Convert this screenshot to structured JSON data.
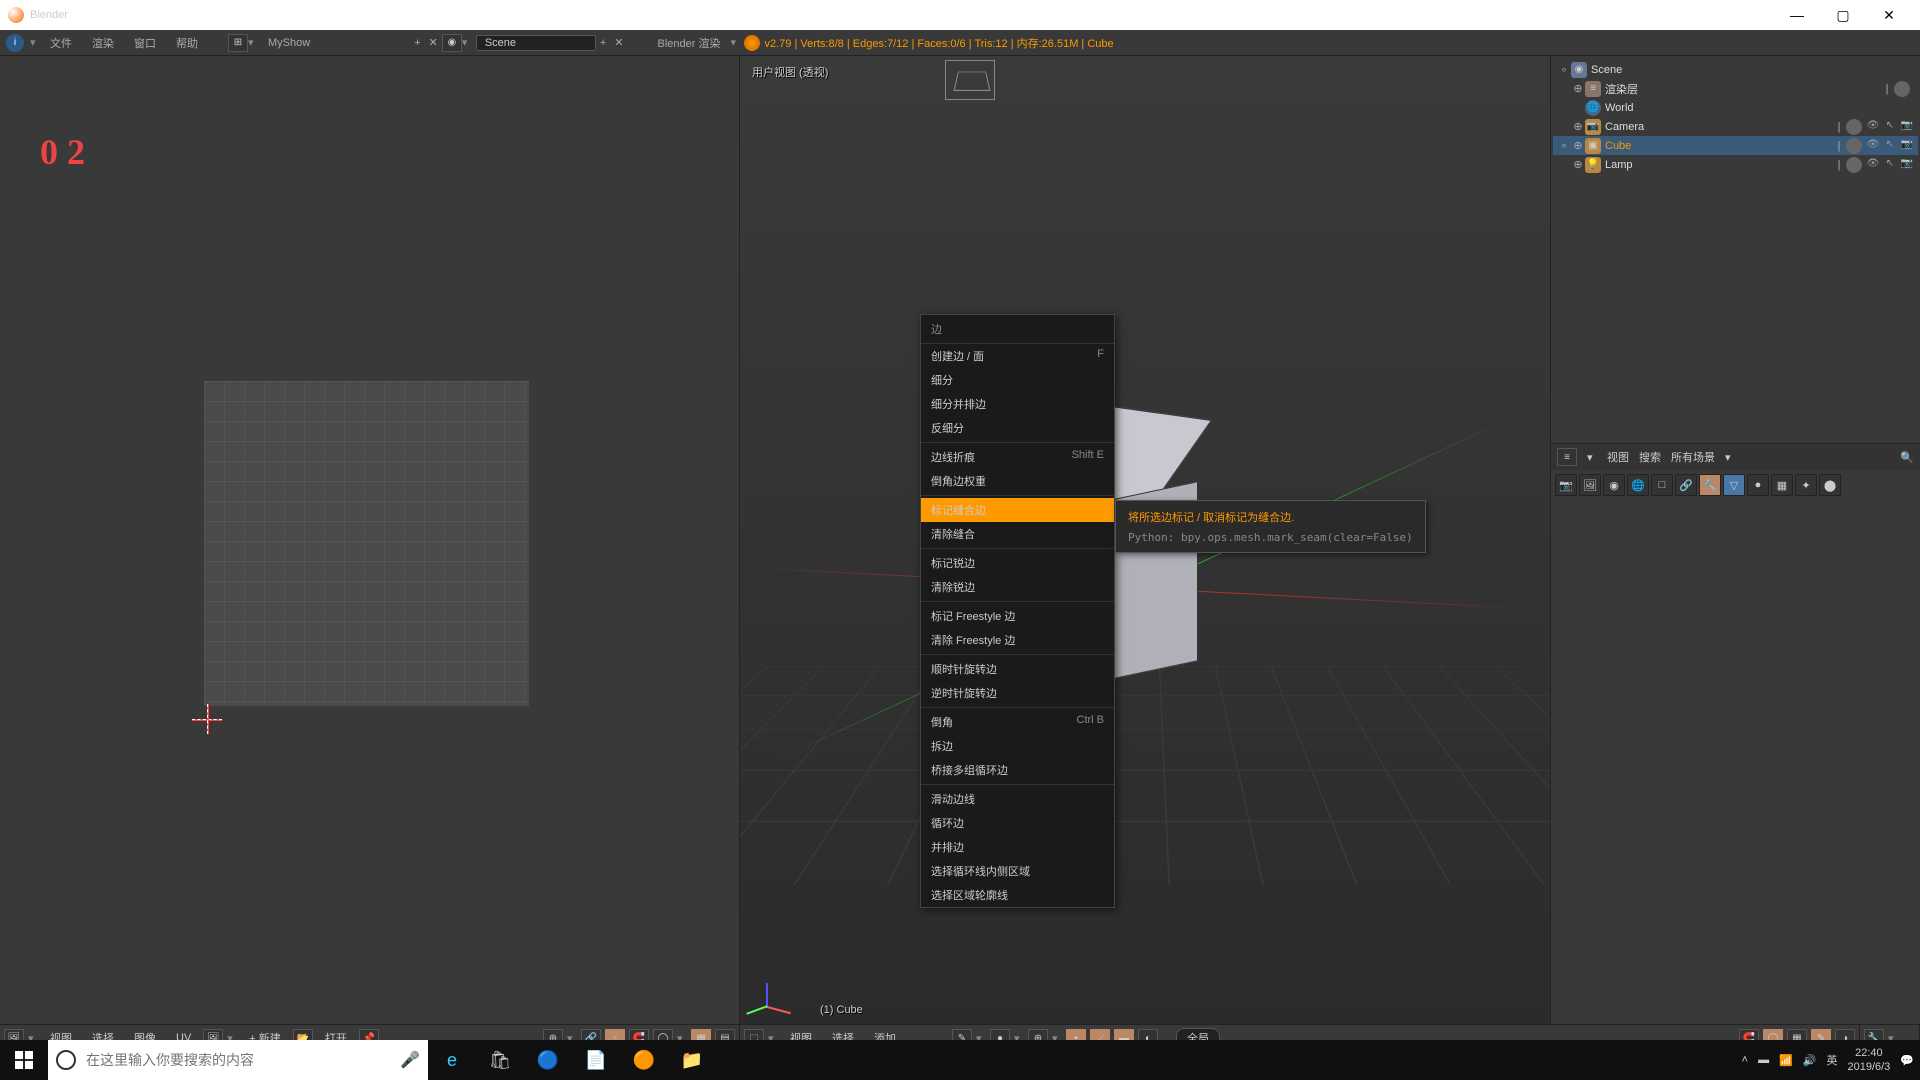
{
  "titlebar": {
    "title": "Blender"
  },
  "winctrl": {
    "min": "—",
    "max": "▢",
    "close": "✕"
  },
  "topmenu": {
    "file": "文件",
    "render": "渲染",
    "window": "窗口",
    "help": "帮助",
    "layout": "MyShow",
    "scene_label": "Scene",
    "engine": "Blender 渲染"
  },
  "stats": "v2.79 | Verts:8/8 | Edges:7/12 | Faces:0/6 | Tris:12 | 内存:26.51M | Cube",
  "uv": {
    "annotation": "0 2"
  },
  "view3d": {
    "label": "用户视图 (透视)",
    "object": "(1) Cube"
  },
  "ctx": {
    "title": "边",
    "items": [
      {
        "l": "创建边 / 面",
        "s": "F"
      },
      {
        "l": "细分"
      },
      {
        "l": "细分并排边"
      },
      {
        "l": "反细分"
      },
      {
        "sep": true
      },
      {
        "l": "边线折痕",
        "s": "Shift E"
      },
      {
        "l": "倒角边权重"
      },
      {
        "sep": true
      },
      {
        "l": "标记缝合边",
        "hl": true
      },
      {
        "l": "清除缝合"
      },
      {
        "sep": true
      },
      {
        "l": "标记锐边"
      },
      {
        "l": "清除锐边"
      },
      {
        "sep": true
      },
      {
        "l": "标记 Freestyle 边"
      },
      {
        "l": "清除 Freestyle 边"
      },
      {
        "sep": true
      },
      {
        "l": "顺时针旋转边"
      },
      {
        "l": "逆时针旋转边"
      },
      {
        "sep": true
      },
      {
        "l": "倒角",
        "s": "Ctrl B"
      },
      {
        "l": "拆边"
      },
      {
        "l": "桥接多组循环边"
      },
      {
        "sep": true
      },
      {
        "l": "滑动边线"
      },
      {
        "l": "循环边"
      },
      {
        "l": "并排边"
      },
      {
        "l": "选择循环线内侧区域"
      },
      {
        "l": "选择区域轮廓线"
      }
    ]
  },
  "tooltip": {
    "desc": "将所选边标记 / 取消标记为缝合边.",
    "py": "Python: bpy.ops.mesh.mark_seam(clear=False)"
  },
  "outliner": {
    "scene": "Scene",
    "renderlayers": "渲染层",
    "world": "World",
    "camera": "Camera",
    "cube": "Cube",
    "lamp": "Lamp"
  },
  "prop": {
    "view": "视图",
    "search": "搜索",
    "allscenes": "所有场景"
  },
  "uvheader": {
    "view": "视图",
    "select": "选择",
    "image": "图像",
    "uv": "UV",
    "new": "新建",
    "open": "打开"
  },
  "v3dheader": {
    "view": "视图",
    "select": "选择",
    "add": "添加",
    "global": "全局"
  },
  "taskbar": {
    "search_ph": "在这里输入你要搜索的内容",
    "ime": "英",
    "time": "22:40",
    "date": "2019/6/3"
  }
}
